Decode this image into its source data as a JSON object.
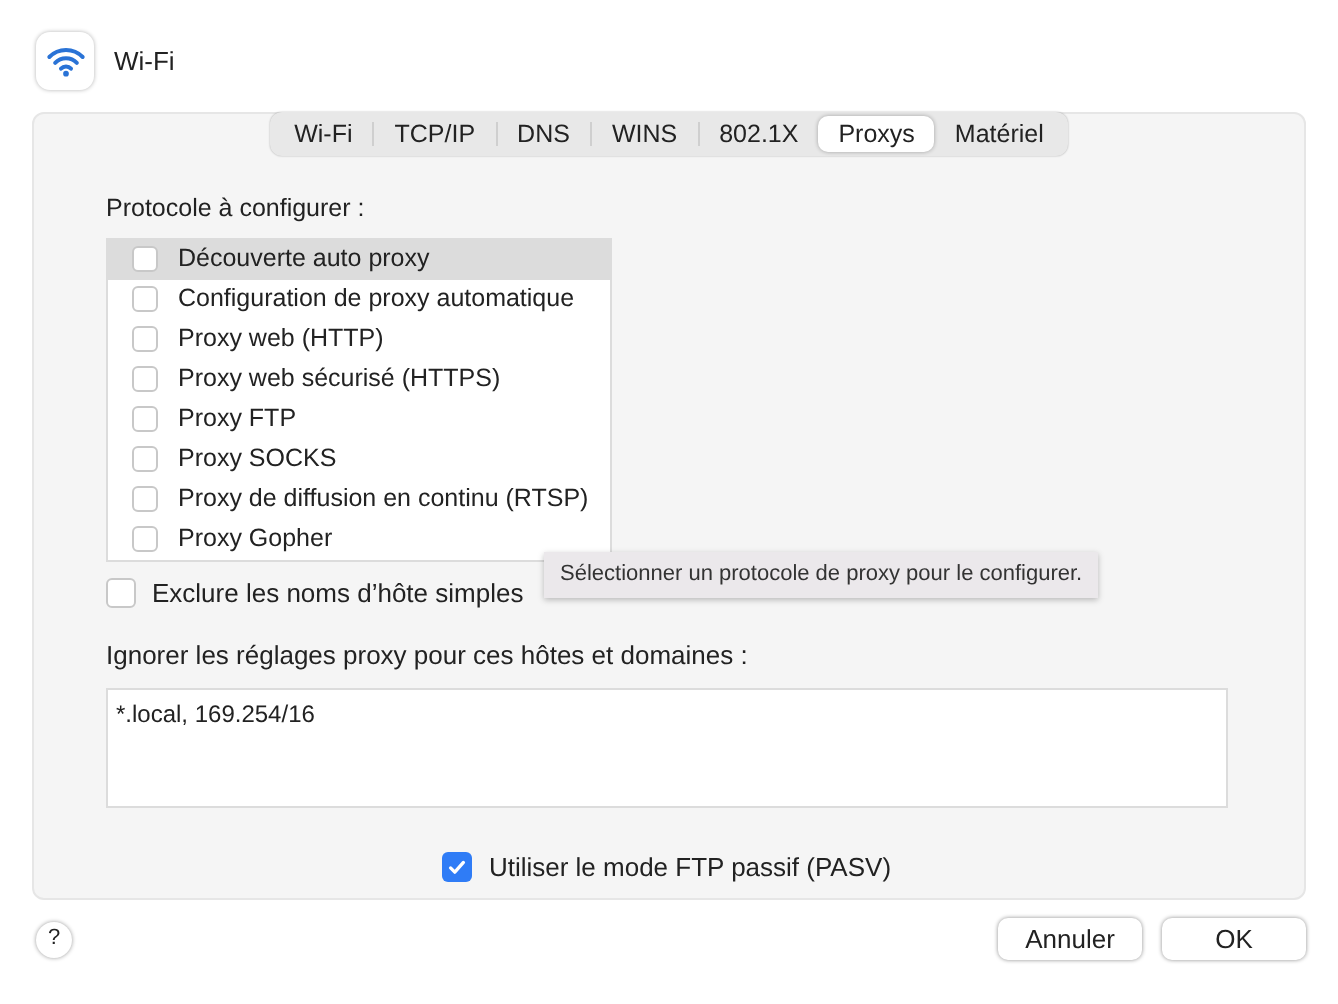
{
  "window": {
    "title": "Wi-Fi"
  },
  "tabs": [
    {
      "label": "Wi-Fi",
      "selected": false
    },
    {
      "label": "TCP/IP",
      "selected": false
    },
    {
      "label": "DNS",
      "selected": false
    },
    {
      "label": "WINS",
      "selected": false
    },
    {
      "label": "802.1X",
      "selected": false
    },
    {
      "label": "Proxys",
      "selected": true
    },
    {
      "label": "Matériel",
      "selected": false
    }
  ],
  "protocols_label": "Protocole à configurer :",
  "protocols": [
    {
      "label": "Découverte auto proxy",
      "checked": false,
      "selected": true
    },
    {
      "label": "Configuration de proxy automatique",
      "checked": false,
      "selected": false
    },
    {
      "label": "Proxy web (HTTP)",
      "checked": false,
      "selected": false
    },
    {
      "label": "Proxy web sécurisé (HTTPS)",
      "checked": false,
      "selected": false
    },
    {
      "label": "Proxy FTP",
      "checked": false,
      "selected": false
    },
    {
      "label": "Proxy SOCKS",
      "checked": false,
      "selected": false
    },
    {
      "label": "Proxy de diffusion en continu (RTSP)",
      "checked": false,
      "selected": false
    },
    {
      "label": "Proxy Gopher",
      "checked": false,
      "selected": false
    }
  ],
  "exclude_simple": {
    "label": "Exclure les noms d’hôte simples",
    "checked": false
  },
  "tooltip": "Sélectionner un protocole de proxy pour le configurer.",
  "bypass_label": "Ignorer les réglages proxy pour ces hôtes et domaines :",
  "bypass_value": "*.local, 169.254/16",
  "passive_ftp": {
    "label": "Utiliser le mode FTP passif (PASV)",
    "checked": true
  },
  "help": "?",
  "buttons": [
    "Annuler",
    "OK"
  ]
}
